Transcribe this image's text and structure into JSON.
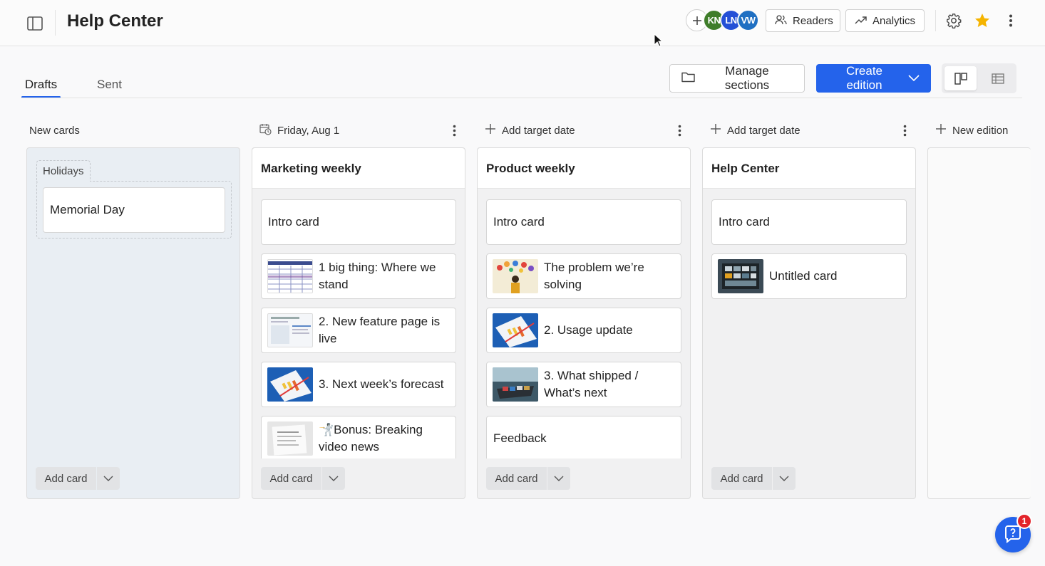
{
  "header": {
    "title": "Help Center",
    "avatars": [
      "KN",
      "LN",
      "VW"
    ],
    "readers_label": "Readers",
    "analytics_label": "Analytics"
  },
  "tabs": [
    {
      "label": "Drafts",
      "active": true
    },
    {
      "label": "Sent",
      "active": false
    }
  ],
  "toolbar": {
    "manage_sections_label": "Manage sections",
    "create_edition_label": "Create edition"
  },
  "columns": {
    "new_cards": {
      "header": "New cards",
      "group_label": "Holidays",
      "cards": [
        "Memorial Day"
      ],
      "add_label": "Add card"
    },
    "marketing": {
      "date": "Friday, Aug 1",
      "title": "Marketing weekly",
      "cards": [
        "Intro card",
        "1 big thing: Where we stand",
        "2. New feature page is live",
        "3. Next week’s forecast",
        "🤺️Bonus: Breaking video news"
      ],
      "add_label": "Add card"
    },
    "product": {
      "date": "Add target date",
      "title": "Product weekly",
      "cards": [
        "Intro card",
        "The problem we’re solving",
        "2. Usage update",
        "3. What shipped / What’s next",
        "Feedback"
      ],
      "add_label": "Add card"
    },
    "help": {
      "date": "Add target date",
      "title": "Help Center",
      "cards": [
        "Intro card",
        "Untitled card"
      ],
      "add_label": "Add card"
    },
    "new_edition_label": "New edition"
  },
  "help_widget": {
    "badge": "1"
  },
  "colors": {
    "accent": "#2463eb",
    "badge": "#e3242b",
    "star": "#f5b400"
  }
}
